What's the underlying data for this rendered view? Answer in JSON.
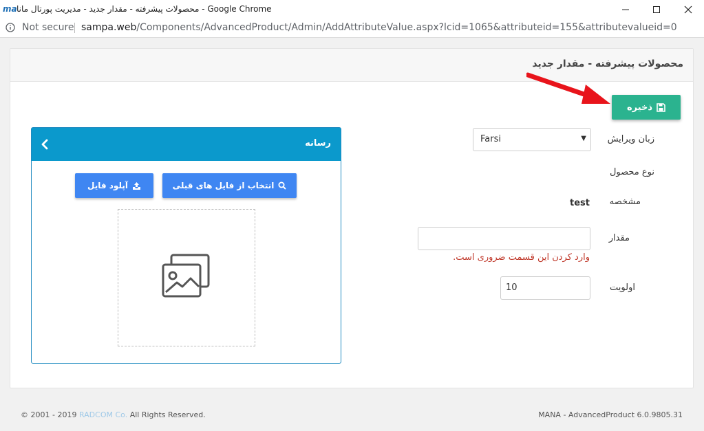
{
  "window": {
    "app_logo": "ma",
    "title": "محصولات پیشرفته - مقدار جدید - مدیریت پورتال مانا - Google Chrome",
    "controls": [
      "minimize",
      "maximize",
      "close"
    ]
  },
  "address_bar": {
    "security_label": "Not secure",
    "url_host": "sampa.web",
    "url_path": "/Components/AdvancedProduct/Admin/AddAttributeValue.aspx?lcid=1065&attributeid=155&attributevalueid=0"
  },
  "page": {
    "title": "محصولات پیشرفته - مقدار جدید",
    "save_label": "ذخیره",
    "accent_color": "#2bb38f"
  },
  "form": {
    "language_label": "زبان ویرایش",
    "language_value": "Farsi",
    "product_type_label": "نوع محصول",
    "attribute_label": "مشخصه",
    "attribute_value": "test",
    "value_label": "مقدار",
    "value_input": "",
    "required_error": "وارد کردن این قسمت ضروری است.",
    "priority_label": "اولویت",
    "priority_value": "10"
  },
  "media": {
    "title": "رسانه",
    "choose_label": "انتخاب از فایل های قبلی",
    "upload_label": "آپلود فایل",
    "header_color": "#0b99cc"
  },
  "footer": {
    "copyright_prefix": "© 2001 - 2019",
    "company": "RADCOM Co.",
    "rights": "All Rights Reserved.",
    "version": "MANA - AdvancedProduct 6.0.9805.31"
  }
}
